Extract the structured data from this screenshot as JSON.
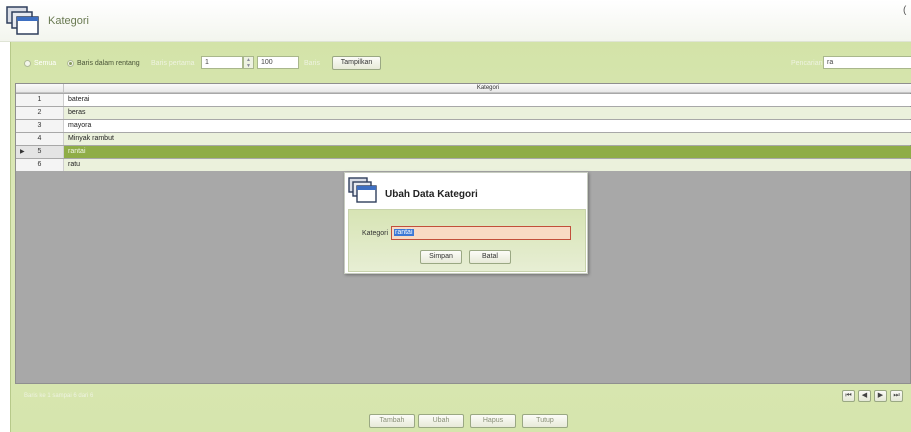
{
  "header": {
    "title": "Kategori",
    "corner_mark": "("
  },
  "filter": {
    "radio_all": "Semua",
    "radio_range": "Baris dalam rentang",
    "first_row_label": "Baris pertama",
    "first_row_value": "1",
    "row_count_value": "100",
    "rows_label": "Baris",
    "show_button": "Tampilkan",
    "search_label": "Pencarian",
    "search_value": "ra"
  },
  "grid": {
    "column_header": "Kategori",
    "rows": [
      {
        "no": "1",
        "kategori": "baterai"
      },
      {
        "no": "2",
        "kategori": "beras"
      },
      {
        "no": "3",
        "kategori": "mayora"
      },
      {
        "no": "4",
        "kategori": "Minyak rambut"
      },
      {
        "no": "5",
        "kategori": "rantai"
      },
      {
        "no": "6",
        "kategori": "ratu"
      }
    ],
    "selected_row": 5
  },
  "status": {
    "text": "Baris ke 1 sampai 6 dari 6"
  },
  "nav": {
    "first": "⏮",
    "prev": "◀",
    "next": "▶",
    "last": "⏭"
  },
  "footer": {
    "add": "Tambah",
    "edit": "Ubah",
    "delete": "Hapus",
    "close": "Tutup"
  },
  "dialog": {
    "title": "Ubah Data Kategori",
    "field_label": "Kategori",
    "field_value": "rantai",
    "save_button": "Simpan",
    "cancel_button": "Batal"
  },
  "colors": {
    "panel_green": "#d6e5ad",
    "selected_row": "#8fad47",
    "grid_background": "#a8a8a8",
    "input_error_border": "#c24f3b"
  }
}
